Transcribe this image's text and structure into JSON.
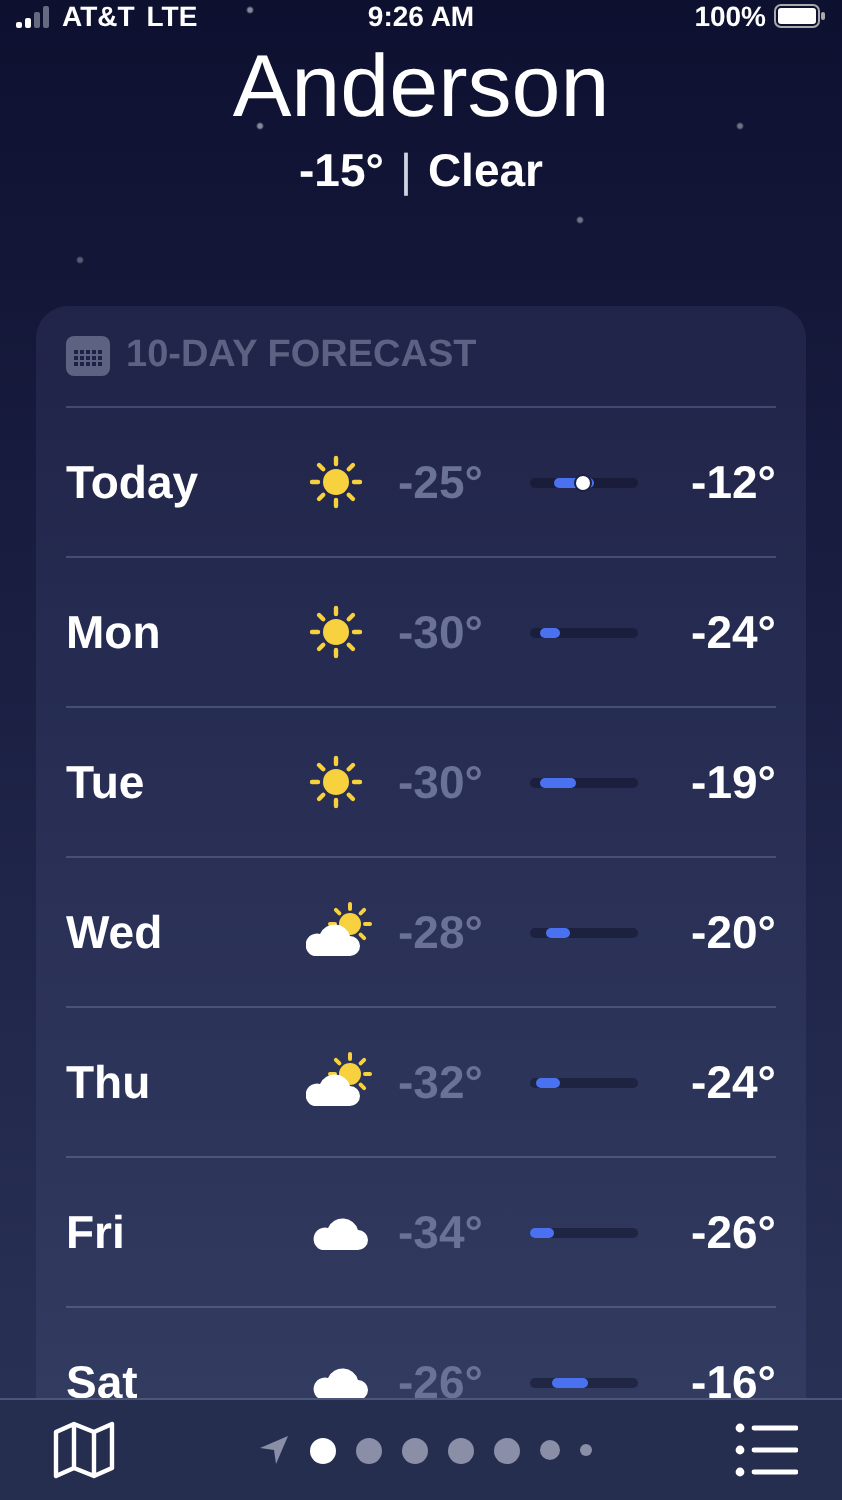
{
  "status_bar": {
    "carrier": "AT&T",
    "network": "LTE",
    "time": "9:26 AM",
    "battery": "100%"
  },
  "location": {
    "city": "Anderson",
    "temperature": "-15°",
    "separator": "|",
    "condition": "Clear"
  },
  "forecast": {
    "title": "10-DAY FORECAST",
    "days": [
      {
        "day": "Today",
        "kind": "sun",
        "low": "-25°",
        "high": "-12°",
        "level": 0.37,
        "now_marker": true
      },
      {
        "day": "Mon",
        "kind": "sun",
        "low": "-30°",
        "high": "-24°",
        "level": 0.18,
        "now_marker": false
      },
      {
        "day": "Tue",
        "kind": "sun",
        "low": "-30°",
        "high": "-19°",
        "level": 0.33,
        "now_marker": false
      },
      {
        "day": "Wed",
        "kind": "partly_cloudy",
        "low": "-28°",
        "high": "-20°",
        "level": 0.22,
        "now_marker": false
      },
      {
        "day": "Thu",
        "kind": "partly_cloudy",
        "low": "-32°",
        "high": "-24°",
        "level": 0.22,
        "now_marker": false
      },
      {
        "day": "Fri",
        "kind": "cloud",
        "low": "-34°",
        "high": "-26°",
        "level": 0.22,
        "now_marker": false
      },
      {
        "day": "Sat",
        "kind": "cloud",
        "low": "-26°",
        "high": "-16°",
        "level": 0.33,
        "now_marker": false
      }
    ]
  },
  "pages": [
    {
      "kind": "location",
      "selected": false
    },
    {
      "kind": "dot",
      "selected": true
    },
    {
      "kind": "dot",
      "selected": false
    },
    {
      "kind": "dot",
      "selected": false
    },
    {
      "kind": "dot",
      "selected": false
    },
    {
      "kind": "dot",
      "selected": false
    },
    {
      "kind": "small_dot",
      "selected": false
    },
    {
      "kind": "tiny_dot",
      "selected": false
    }
  ]
}
